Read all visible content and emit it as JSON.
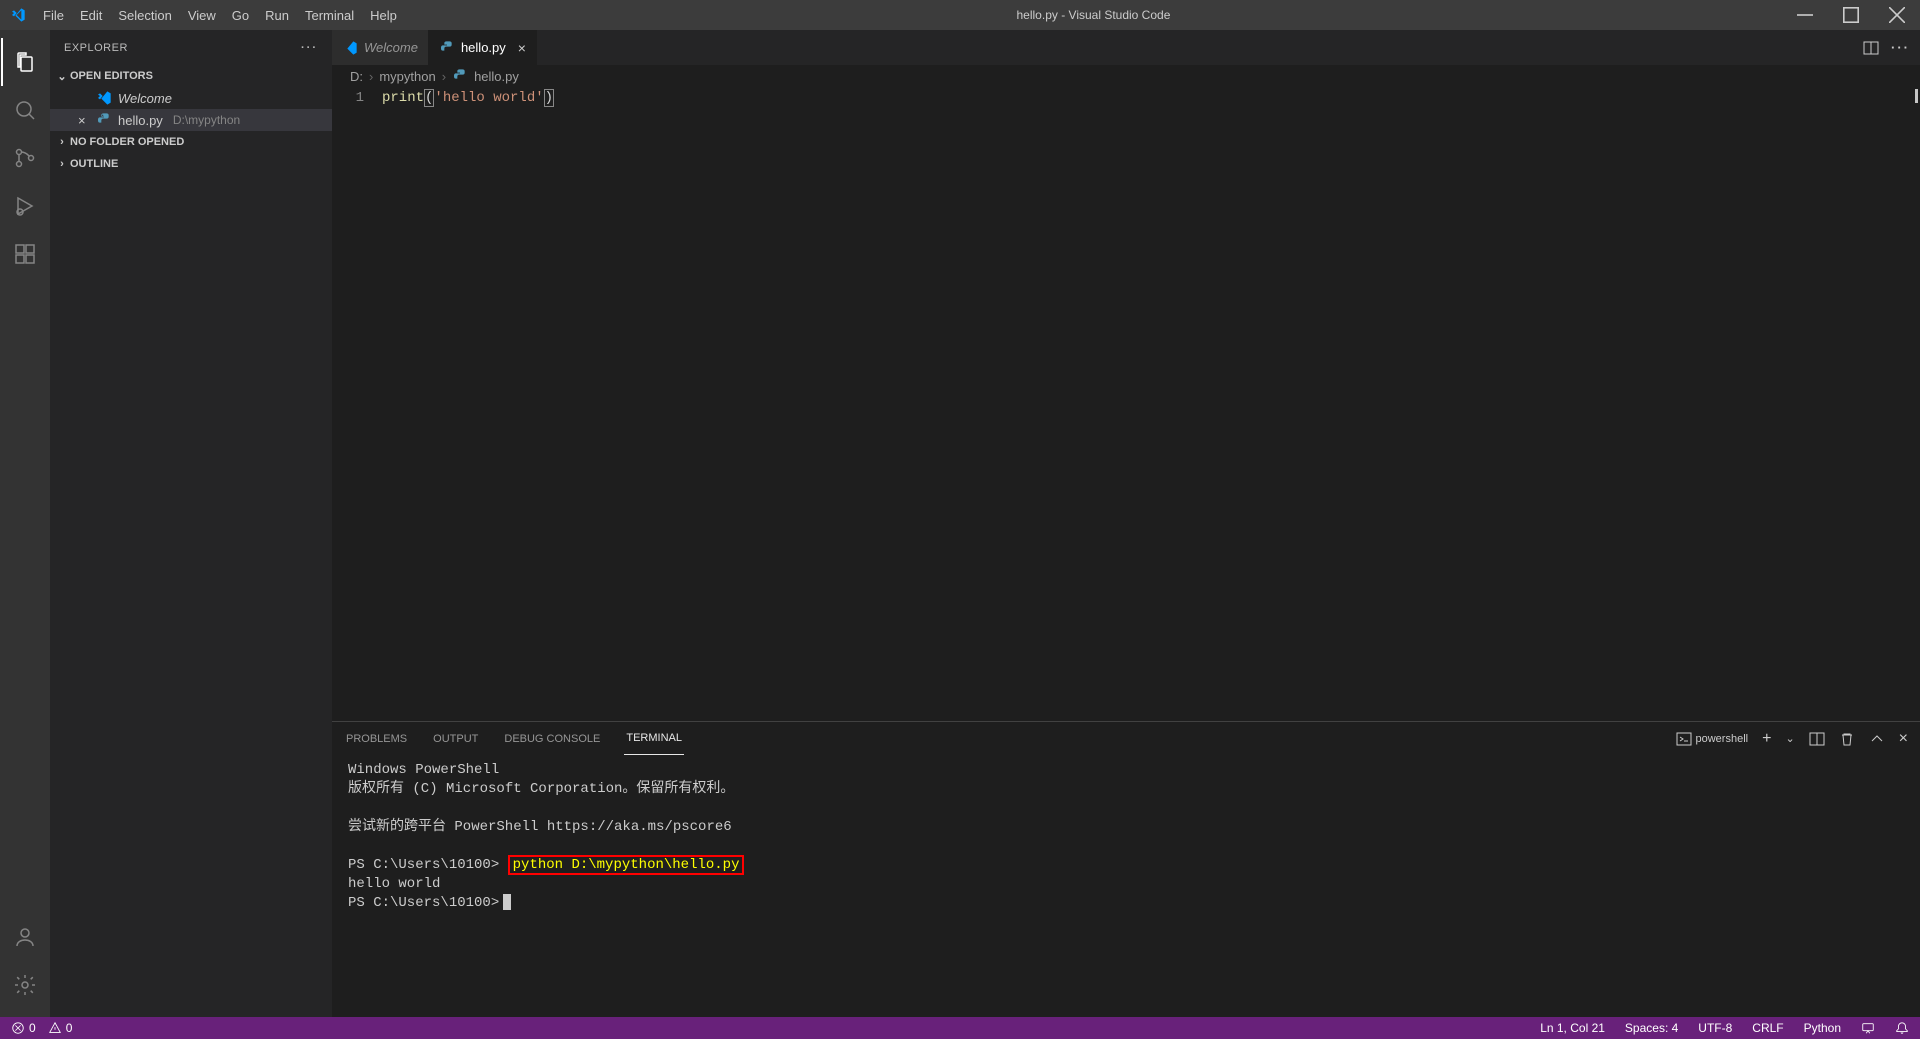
{
  "title": "hello.py - Visual Studio Code",
  "menubar": [
    "File",
    "Edit",
    "Selection",
    "View",
    "Go",
    "Run",
    "Terminal",
    "Help"
  ],
  "sidebar": {
    "title": "EXPLORER",
    "sections": {
      "open_editors": "OPEN EDITORS",
      "no_folder": "NO FOLDER OPENED",
      "outline": "OUTLINE"
    },
    "files": [
      {
        "name": "Welcome",
        "hint": "",
        "italic": true
      },
      {
        "name": "hello.py",
        "hint": "D:\\mypython",
        "italic": false
      }
    ]
  },
  "tabs": [
    {
      "label": "Welcome",
      "active": false,
      "italic": true
    },
    {
      "label": "hello.py",
      "active": true,
      "italic": false
    }
  ],
  "breadcrumb": {
    "root": "D:",
    "folder": "mypython",
    "file": "hello.py"
  },
  "editor": {
    "line_no": "1",
    "fn": "print",
    "lp": "(",
    "str": "'hello world'",
    "rp": ")"
  },
  "panel": {
    "tabs": [
      "PROBLEMS",
      "OUTPUT",
      "DEBUG CONSOLE",
      "TERMINAL"
    ],
    "shell_label": "powershell",
    "terminal": {
      "line1": "Windows PowerShell",
      "line2": "版权所有 (C) Microsoft Corporation。保留所有权利。",
      "line3": "尝试新的跨平台 PowerShell https://aka.ms/pscore6",
      "prompt1": "PS C:\\Users\\10100>",
      "cmd": "python D:\\mypython\\hello.py",
      "output": "hello world",
      "prompt2": "PS C:\\Users\\10100>"
    }
  },
  "statusbar": {
    "errors": "0",
    "warnings": "0",
    "ln_col": "Ln 1, Col 21",
    "spaces": "Spaces: 4",
    "encoding": "UTF-8",
    "eol": "CRLF",
    "lang": "Python"
  }
}
